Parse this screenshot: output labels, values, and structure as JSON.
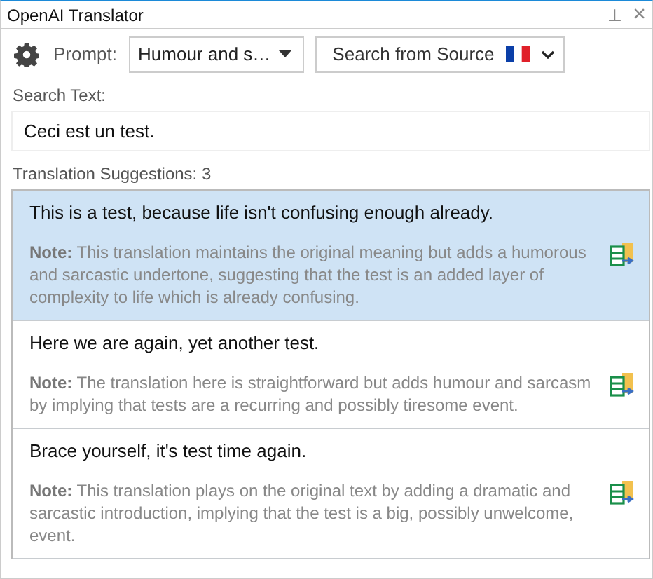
{
  "window": {
    "title": "OpenAI Translator",
    "pin_glyph": "⊥",
    "close_glyph": "×"
  },
  "toolbar": {
    "prompt_label": "Prompt:",
    "prompt_value": "Humour and s…",
    "search_button": "Search from Source"
  },
  "search": {
    "label": "Search Text:",
    "value": "Ceci est un test."
  },
  "suggestions": {
    "label": "Translation Suggestions: 3",
    "items": [
      {
        "text": "This is a test, because life isn't confusing enough already.",
        "note": "**Note:**  This translation maintains the original meaning but adds a humorous and sarcastic undertone, suggesting that the test is an added layer of complexity to life which is already confusing.",
        "selected": true
      },
      {
        "text": "Here we are again, yet another test.",
        "note": "**Note:**  The translation here is straightforward but adds humour and sarcasm by implying that tests are a recurring and possibly tiresome event.",
        "selected": false
      },
      {
        "text": "Brace yourself, it's test time again.",
        "note": "**Note:**  This translation plays on the original text by adding a dramatic and sarcastic introduction, implying that the test is a big, possibly unwelcome, event.",
        "selected": false
      }
    ]
  }
}
